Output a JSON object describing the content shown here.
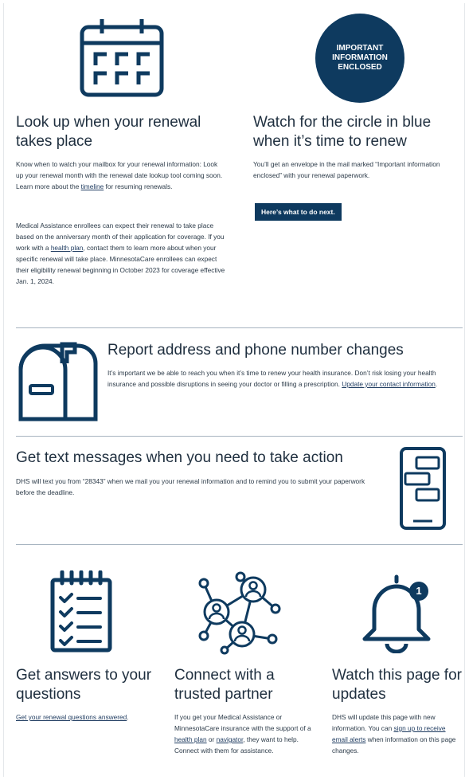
{
  "section1": {
    "left": {
      "icon": "calendar-icon",
      "title": "Look up when your renewal takes place",
      "p1_before_link": "Know when to watch your mailbox for your renewal information: Look up your renewal month with the renewal date lookup tool coming soon. Learn more about the ",
      "p1_link": "timeline",
      "p1_after_link": " for resuming renewals.",
      "p2_before_link": "Medical Assistance enrollees can expect their renewal to take place based on the anniversary month of their application for coverage. If you work with a ",
      "p2_link": "health plan",
      "p2_after_link": ", contact them to learn more about when your specific renewal will take place.  MinnesotaCare enrollees can expect their eligibility renewal beginning in October 2023 for coverage effective Jan. 1, 2024."
    },
    "right": {
      "badge_line1": "IMPORTANT",
      "badge_line2": "INFORMATION",
      "badge_line3": "ENCLOSED",
      "title": "Watch for the circle in blue when it’s time to renew",
      "body": "You’ll get an envelope in the mail marked “Important information enclosed” with your renewal paperwork.",
      "button": "Here’s what to do next."
    }
  },
  "section2": {
    "icon": "mailbox-icon",
    "title": "Report address and phone number changes",
    "body": "It’s important we be able to reach you when it’s time to renew your health insurance. Don’t risk losing your health insurance and possible disruptions in seeing your doctor or filling a prescription. ",
    "link": "Update your contact information",
    "after_link": "."
  },
  "section3": {
    "icon": "phone-messages-icon",
    "title": "Get text messages when you need to take action",
    "body": "DHS will text you from “28343” when we mail you your renewal information and to remind you to submit your paperwork before the deadline."
  },
  "section4": {
    "col1": {
      "icon": "checklist-icon",
      "title": "Get answers to your questions",
      "link": "Get your renewal questions answered",
      "after_link": "."
    },
    "col2": {
      "icon": "network-people-icon",
      "title": "Connect with a trusted partner",
      "before_link1": "If you get your Medical Assistance or MinnesotaCare insurance with the support of a ",
      "link1": "health plan",
      "between": " or ",
      "link2": "navigator",
      "after_link2": ", they want to help. Connect with them for assistance."
    },
    "col3": {
      "icon": "bell-notification-icon",
      "badge": "1",
      "title": "Watch this page for updates",
      "before_link": "DHS will update this page with new information. You can ",
      "link": "sign up to receive email alerts",
      "after_link": " when information on this page changes."
    }
  },
  "colors": {
    "navy": "#0e3a5f",
    "rule": "#a7b4c0"
  }
}
